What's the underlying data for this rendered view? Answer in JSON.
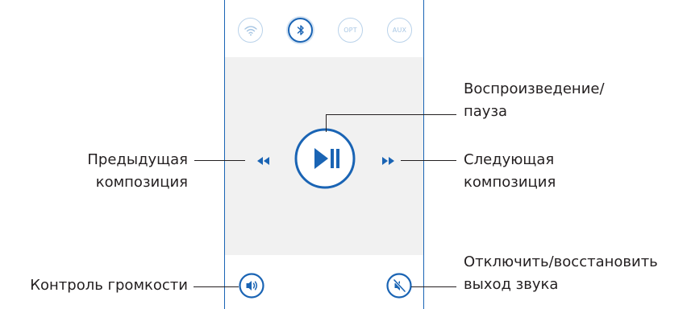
{
  "sources": [
    {
      "name": "wifi",
      "label": ""
    },
    {
      "name": "bluetooth",
      "label": ""
    },
    {
      "name": "optical",
      "label": "OPT"
    },
    {
      "name": "aux",
      "label": "AUX"
    }
  ],
  "labels": {
    "play_pause": [
      "Воспроизведение/",
      "пауза"
    ],
    "previous": [
      "Предыдущая",
      "композиция"
    ],
    "next": [
      "Следующая",
      "композиция"
    ],
    "volume": "Контроль громкости",
    "mute": [
      "Отключить/восстановить",
      "выход звука"
    ]
  },
  "icons": {
    "wifi": "wifi-icon",
    "bluetooth": "bluetooth-icon",
    "previous": "rewind-icon",
    "play_pause": "play-pause-icon",
    "next": "fast-forward-icon",
    "volume": "speaker-volume-icon",
    "mute": "speaker-muted-icon"
  },
  "colors": {
    "accent": "#1a64b4",
    "inactive": "#b9d2ea",
    "panel": "#f1f1f1"
  }
}
